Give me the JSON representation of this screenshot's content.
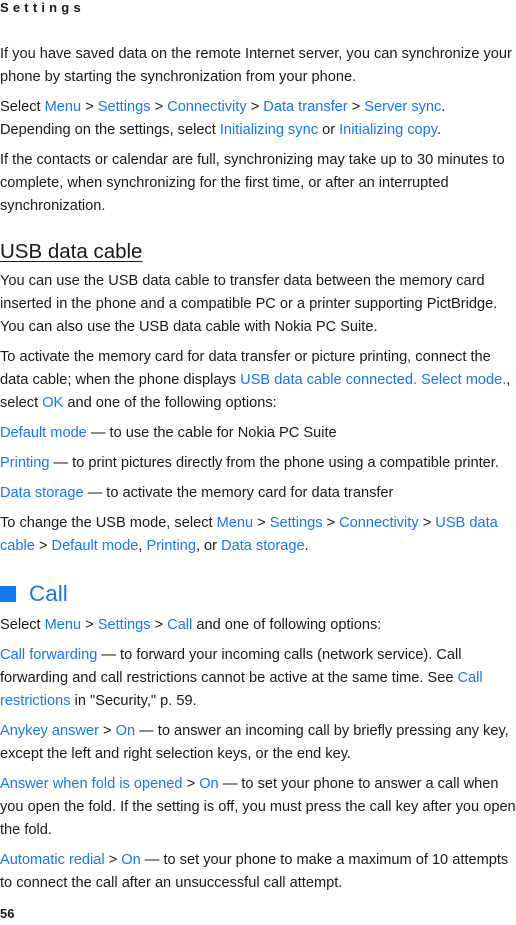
{
  "running_head": "Settings",
  "page_number": "56",
  "colors": {
    "link": "#1677f0",
    "text": "#1a1a1a"
  },
  "sync": {
    "p1": "If you have saved data on the remote Internet server, you can synchronize your phone by starting the synchronization from your phone.",
    "p2": {
      "select": "Select ",
      "path": [
        "Menu",
        "Settings",
        "Connectivity",
        "Data transfer",
        "Server sync"
      ],
      "sep": " > ",
      "mid": ". Depending on the settings, select ",
      "opt1": "Initializing sync",
      "or": " or ",
      "opt2": "Initializing copy",
      "end": "."
    },
    "p3": "If the contacts or calendar are full, synchronizing may take up to 30 minutes to complete, when synchronizing for the first time, or after an interrupted synchronization."
  },
  "usb": {
    "heading": "USB data cable",
    "p1": "You can use the USB data cable to transfer data between the memory card inserted in the phone and a compatible PC or a printer supporting PictBridge. You can also use the USB data cable with Nokia PC Suite.",
    "p2": {
      "a": "To activate the memory card for data transfer or picture printing, connect the data cable; when the phone displays ",
      "msg": "USB data cable connected. Select mode.",
      "b": ", select ",
      "ok": "OK",
      "c": " and one of the following options:"
    },
    "options": [
      {
        "term": "Default mode",
        "desc": " — to use the cable for Nokia PC Suite"
      },
      {
        "term": "Printing",
        "desc": " — to print pictures directly from the phone using a compatible printer."
      },
      {
        "term": "Data storage",
        "desc": " — to activate the memory card for data transfer"
      }
    ],
    "change": {
      "a": "To change the USB mode, select ",
      "path": [
        "Menu",
        "Settings",
        "Connectivity",
        "USB data cable"
      ],
      "sep": " > ",
      "opt1": "Default mode",
      "comma": ", ",
      "opt2": "Printing",
      "or": ", or ",
      "opt3": "Data storage",
      "end": "."
    }
  },
  "call": {
    "heading": "Call",
    "intro": {
      "select": "Select ",
      "path": [
        "Menu",
        "Settings",
        "Call"
      ],
      "sep": " > ",
      "end": " and one of following options:"
    },
    "forwarding": {
      "term": "Call forwarding",
      "a": " — to forward your incoming calls (network service). Call forwarding and call restrictions cannot be active at the same time. See ",
      "link": "Call restrictions",
      "b": " in \"Security,\" p. 59."
    },
    "items": [
      {
        "term": "Anykey answer",
        "sep": " > ",
        "value": "On",
        "desc": " — to answer an incoming call by briefly pressing any key, except the left and right selection keys, or the end key."
      },
      {
        "term": "Answer when fold is opened",
        "sep": " > ",
        "value": "On",
        "desc": " — to set your phone to answer a call when you open the fold. If the setting is off, you must press the call key after you open the fold."
      },
      {
        "term": "Automatic redial",
        "sep": " > ",
        "value": "On",
        "desc": " — to set your phone to make a maximum of 10 attempts to connect the call after an unsuccessful call attempt."
      }
    ]
  }
}
